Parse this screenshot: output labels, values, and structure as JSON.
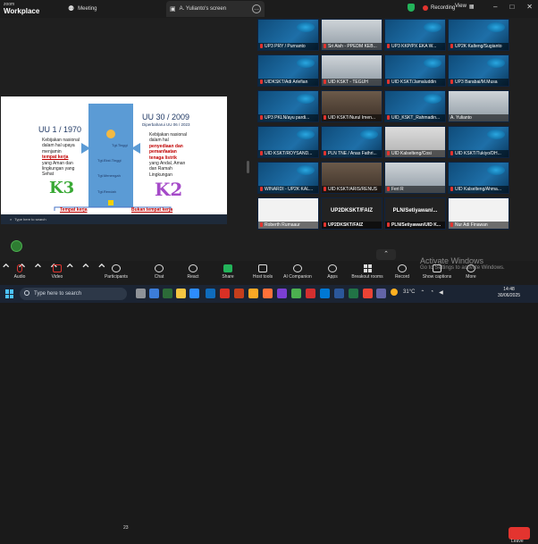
{
  "app": {
    "brand_small": "zoom",
    "brand_big": "Workplace",
    "meeting_tab": "Meeting",
    "screen_tab": "A. Yulianto's screen",
    "recording": "Recording",
    "view": "View"
  },
  "slide": {
    "left_title": "UU 1 / 1970",
    "left_lines": [
      "Kebijakan nasional",
      "dalam hal upaya",
      "menjamin",
      "tempat kerja",
      "yang Aman dan",
      "lingkungan yang",
      "Sehat"
    ],
    "k3": "K3",
    "center_labels": [
      "Tgt.Tinggi",
      "Tgt.Ekst.Tinggi",
      "Tgt.Menengah",
      "Tgt.Rendah"
    ],
    "right_title": "UU 30 / 2009",
    "right_sub": "Diperbaharui UU 06 / 2023",
    "right_lines": [
      "Kebijakan nasional",
      "dalam hal",
      "penyediaan dan",
      "pemanfaatan",
      "tenaga listrik",
      "yang Andal, Aman",
      "dan Ramah",
      "Lingkungan"
    ],
    "k2": "K2",
    "bottom_left": "Tempat kerja",
    "bottom_right": "Bukan tempat kerja",
    "mini_search": "Type here to search"
  },
  "tiles": [
    {
      "name": "UP3 PRY / Purnanto",
      "style": "t-blue",
      "muted": true
    },
    {
      "name": "Sri Aish - PPEDM KEB...",
      "style": "t-photo",
      "muted": true
    },
    {
      "name": "UP3 KKP/PX EKA W...",
      "style": "t-blue",
      "muted": true
    },
    {
      "name": "UP2K Kalteng/Sugianto",
      "style": "t-blue",
      "muted": true
    },
    {
      "name": "UIDKSKT/Adi Arlefian",
      "style": "t-blue",
      "muted": true
    },
    {
      "name": "UID KSKT - TEGUH",
      "style": "t-photo",
      "muted": true
    },
    {
      "name": "UID KSKT/Jamaluddin",
      "style": "t-blue",
      "muted": true
    },
    {
      "name": "UP3 Barabai/M.Musa",
      "style": "t-blue",
      "muted": true
    },
    {
      "name": "UP3 PKLN/ayu pardi...",
      "style": "t-blue",
      "muted": true
    },
    {
      "name": "UID KSKT/Nurul Imen...",
      "style": "t-room",
      "muted": true
    },
    {
      "name": "UID_KSKT_Rahmadin...",
      "style": "t-blue",
      "muted": true
    },
    {
      "name": "A. Yulianto",
      "style": "t-photo",
      "muted": false
    },
    {
      "name": "UID KSKT/ROYSAND...",
      "style": "t-blue",
      "muted": true
    },
    {
      "name": "PLN TNE / Anas Fathri...",
      "style": "t-blue",
      "muted": true
    },
    {
      "name": "UID Kalselteng/Cosi",
      "style": "t-gray",
      "muted": true
    },
    {
      "name": "UID KSKT/Tukiyo/DH...",
      "style": "t-blue",
      "muted": true
    },
    {
      "name": "WINARDI - UP2K KAL...",
      "style": "t-blue",
      "muted": true
    },
    {
      "name": "UID KSKT/ARIS/RENUS",
      "style": "t-room",
      "muted": true
    },
    {
      "name": "Feri R",
      "style": "t-photo",
      "muted": true
    },
    {
      "name": "UID Kalselteng/Ahma...",
      "style": "t-blue",
      "muted": true
    },
    {
      "name": "Roberth Rumaaur",
      "style": "t-white",
      "muted": true
    },
    {
      "name": "UP2DKSKT/FAIZ",
      "style": "t-text",
      "muted": true,
      "big": "UP2DKSKT/FAIZ"
    },
    {
      "name": "PLN/Setiyawan/UID K...",
      "style": "t-text",
      "muted": true,
      "big": "PLN/Setiyawan/..."
    },
    {
      "name": "Nur Adi Finawan",
      "style": "t-white",
      "muted": true
    }
  ],
  "toolbar": {
    "audio": "Audio",
    "video": "Video",
    "participants": "Participants",
    "participants_count": "23",
    "chat": "Chat",
    "react": "React",
    "share": "Share",
    "host_tools": "Host tools",
    "ai_companion": "AI Companion",
    "apps": "Apps",
    "breakout": "Breakout rooms",
    "record": "Record",
    "captions": "Show captions",
    "more": "More",
    "leave": "Leave"
  },
  "overlay": {
    "activate_title": "Activate Windows",
    "activate_sub": "Go to Settings to activate Windows."
  },
  "taskbar": {
    "search_placeholder": "Type here to search",
    "temperature": "31°C",
    "time": "14:48",
    "date": "30/06/2025"
  }
}
